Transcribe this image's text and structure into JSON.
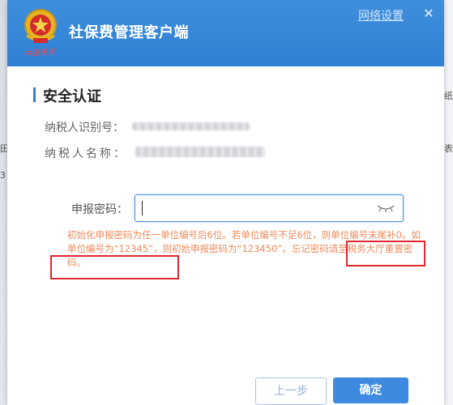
{
  "window": {
    "app_title": "社保费管理客户端",
    "emblem_caption": "中国税务",
    "network_settings": "网络设置",
    "close": "✕"
  },
  "section": {
    "title": "安全认证"
  },
  "fields": {
    "taxpayer_id_label": "纳税人识别号：",
    "taxpayer_name_label": "纳税人名称："
  },
  "password": {
    "label": "申报密码："
  },
  "hint": {
    "text": "初始化申报密码为任一单位编号后6位。若单位编号不足6位，则单位编号末尾补0。如单位编号为“12345”，则初始申报密码为“123450”。忘记密码请至税务大厅重置密码。"
  },
  "buttons": {
    "prev": "上一步",
    "ok": "确定"
  },
  "background": {
    "right_chars": [
      "纸",
      "表"
    ],
    "left_chars": [
      "田",
      "3"
    ]
  }
}
